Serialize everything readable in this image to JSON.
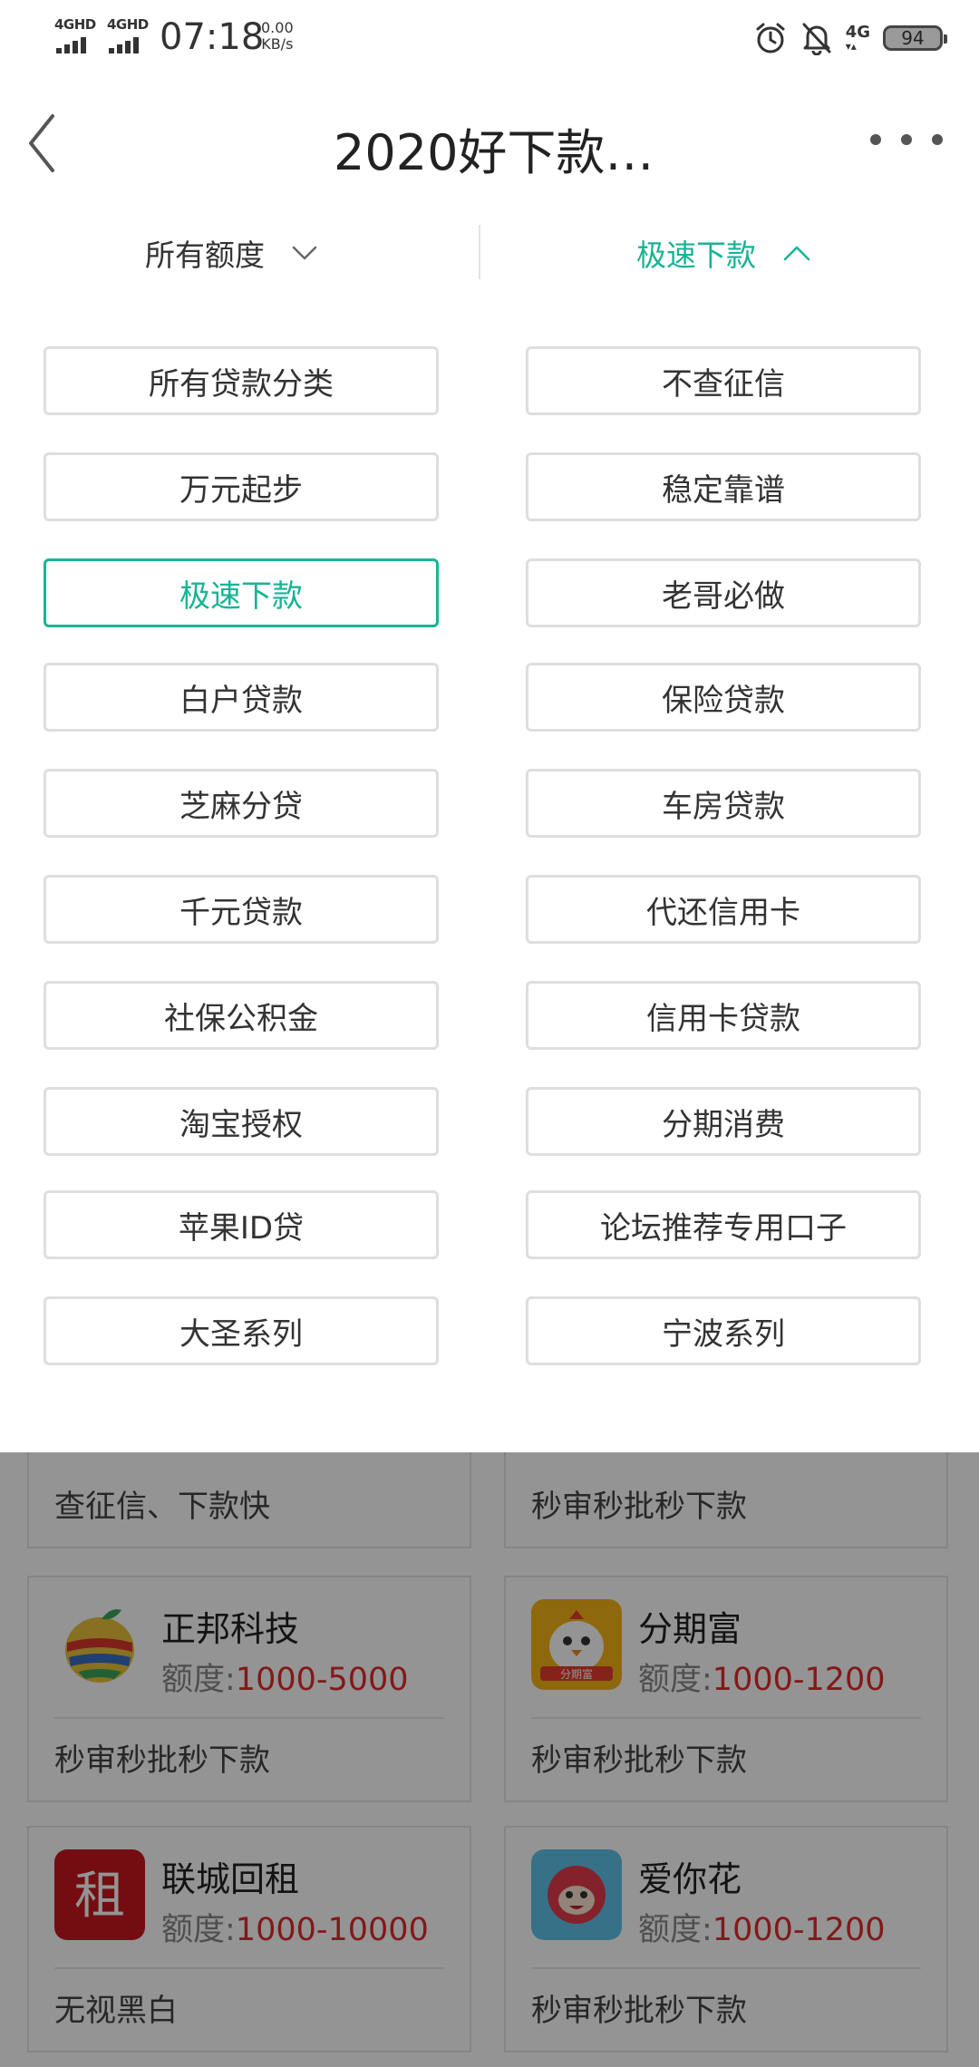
{
  "status_bar": {
    "signal1": "4GHD",
    "signal2": "4GHD",
    "time": "07:18",
    "net_speed_value": "0.00",
    "net_speed_unit": "KB/s",
    "network_type": "4G",
    "battery_level": "94",
    "icons": [
      "alarm-icon",
      "bell-off-icon"
    ]
  },
  "header": {
    "title": "2020好下款…",
    "back_icon": "chevron-left-icon",
    "more_icon": "more-dots-icon"
  },
  "filters": {
    "amount_label": "所有额度",
    "category_label": "极速下款",
    "amount_icon": "chevron-down-icon",
    "category_icon": "chevron-up-icon",
    "active_color": "#1ab394"
  },
  "categories": [
    {
      "label": "所有贷款分类",
      "active": false
    },
    {
      "label": "不查征信",
      "active": false
    },
    {
      "label": "万元起步",
      "active": false
    },
    {
      "label": "稳定靠谱",
      "active": false
    },
    {
      "label": "极速下款",
      "active": true
    },
    {
      "label": "老哥必做",
      "active": false
    },
    {
      "label": "白户贷款",
      "active": false
    },
    {
      "label": "保险贷款",
      "active": false
    },
    {
      "label": "芝麻分贷",
      "active": false
    },
    {
      "label": "车房贷款",
      "active": false
    },
    {
      "label": "千元贷款",
      "active": false
    },
    {
      "label": "代还信用卡",
      "active": false
    },
    {
      "label": "社保公积金",
      "active": false
    },
    {
      "label": "信用卡贷款",
      "active": false
    },
    {
      "label": "淘宝授权",
      "active": false
    },
    {
      "label": "分期消费",
      "active": false
    },
    {
      "label": "苹果ID贷",
      "active": false
    },
    {
      "label": "论坛推荐专用口子",
      "active": false
    },
    {
      "label": "大圣系列",
      "active": false
    },
    {
      "label": "宁波系列",
      "active": false
    }
  ],
  "list": {
    "partial_top": [
      "查征信、下款快",
      "秒审秒批秒下款"
    ],
    "amount_prefix": "额度:",
    "cards": [
      {
        "name": "正邦科技",
        "amount": "1000-5000",
        "desc": "秒审秒批秒下款",
        "icon": "apple-logo-icon"
      },
      {
        "name": "分期富",
        "amount": "1000-1200",
        "desc": "秒审秒批秒下款",
        "icon": "chick-logo-icon",
        "logo_text": "分期富"
      },
      {
        "name": "联城回租",
        "amount": "1000-10000",
        "desc": "无视黑白",
        "icon": "zu-logo-icon",
        "logo_text": "租"
      },
      {
        "name": "爱你花",
        "amount": "1000-1200",
        "desc": "秒审秒批秒下款",
        "icon": "mascot-logo-icon"
      }
    ]
  }
}
